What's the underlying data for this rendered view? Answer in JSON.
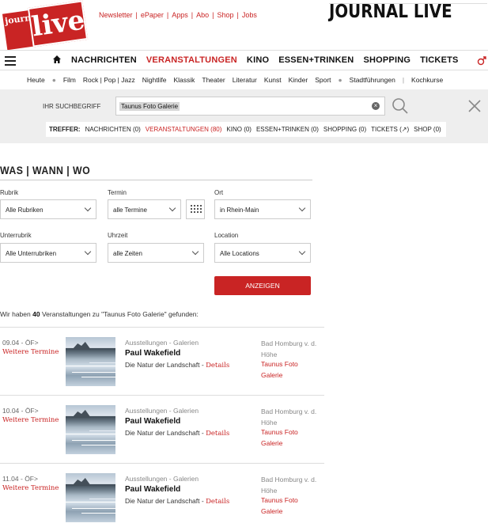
{
  "logo": {
    "line1": "journal",
    "line2": "live"
  },
  "toplinks": [
    "Newsletter",
    "ePaper",
    "Apps",
    "Abo",
    "Shop",
    "Jobs"
  ],
  "brand": "JOURNAL LIVE",
  "mainnav": {
    "items": [
      {
        "label": "NACHRICHTEN",
        "active": false
      },
      {
        "label": "VERANSTALTUNGEN",
        "active": true
      },
      {
        "label": "KINO",
        "active": false
      },
      {
        "label": "ESSEN+TRINKEN",
        "active": false
      },
      {
        "label": "SHOPPING",
        "active": false
      },
      {
        "label": "TICKETS",
        "active": false
      }
    ]
  },
  "subnav": [
    "Heute",
    "Film",
    "Rock | Pop | Jazz",
    "Nightlife",
    "Klassik",
    "Theater",
    "Literatur",
    "Kunst",
    "Kinder",
    "Sport",
    "Stadtführungen",
    "Kochkurse"
  ],
  "search": {
    "label": "IHR SUCHBEGRIFF",
    "value": "Taunus Foto Galerie",
    "hits_label": "TREFFER:",
    "hits": [
      {
        "label": "NACHRICHTEN (0)",
        "active": false
      },
      {
        "label": "VERANSTALTUNGEN (80)",
        "active": true
      },
      {
        "label": "KINO (0)",
        "active": false
      },
      {
        "label": "ESSEN+TRINKEN (0)",
        "active": false
      },
      {
        "label": "SHOPPING (0)",
        "active": false
      },
      {
        "label": "TICKETS (↗)",
        "active": false
      },
      {
        "label": "SHOP (0)",
        "active": false
      }
    ]
  },
  "section": {
    "title": "WAS | WANN | WO"
  },
  "filters": {
    "rubrik": {
      "label": "Rubrik",
      "value": "Alle Rubriken"
    },
    "termin": {
      "label": "Termin",
      "value": "alle Termine"
    },
    "ort": {
      "label": "Ort",
      "value": "in Rhein-Main"
    },
    "unterrubrik": {
      "label": "Unterrubrik",
      "value": "Alle Unterrubriken"
    },
    "uhrzeit": {
      "label": "Uhrzeit",
      "value": "alle Zeiten"
    },
    "location": {
      "label": "Location",
      "value": "Alle Locations"
    },
    "submit": "ANZEIGEN"
  },
  "result": {
    "prefix": "Wir haben",
    "count": "40",
    "suffix": "Veranstaltungen zu \"Taunus Foto Galerie\" gefunden:"
  },
  "events": [
    {
      "date": "09.04 - ÖF>",
      "more": "Weitere Termine",
      "category": "Ausstellungen - Galerien",
      "title": "Paul Wakefield",
      "subtitle": "Die Natur der Landschaft - ",
      "details": "Details",
      "city": "Bad Homburg v. d. Höhe",
      "location": "Taunus Foto Galerie"
    },
    {
      "date": "10.04 - ÖF>",
      "more": "Weitere Termine",
      "category": "Ausstellungen - Galerien",
      "title": "Paul Wakefield",
      "subtitle": "Die Natur der Landschaft - ",
      "details": "Details",
      "city": "Bad Homburg v. d. Höhe",
      "location": "Taunus Foto Galerie"
    },
    {
      "date": "11.04 - ÖF>",
      "more": "Weitere Termine",
      "category": "Ausstellungen - Galerien",
      "title": "Paul Wakefield",
      "subtitle": "Die Natur der Landschaft - ",
      "details": "Details",
      "city": "Bad Homburg v. d. Höhe",
      "location": "Taunus Foto Galerie"
    }
  ]
}
